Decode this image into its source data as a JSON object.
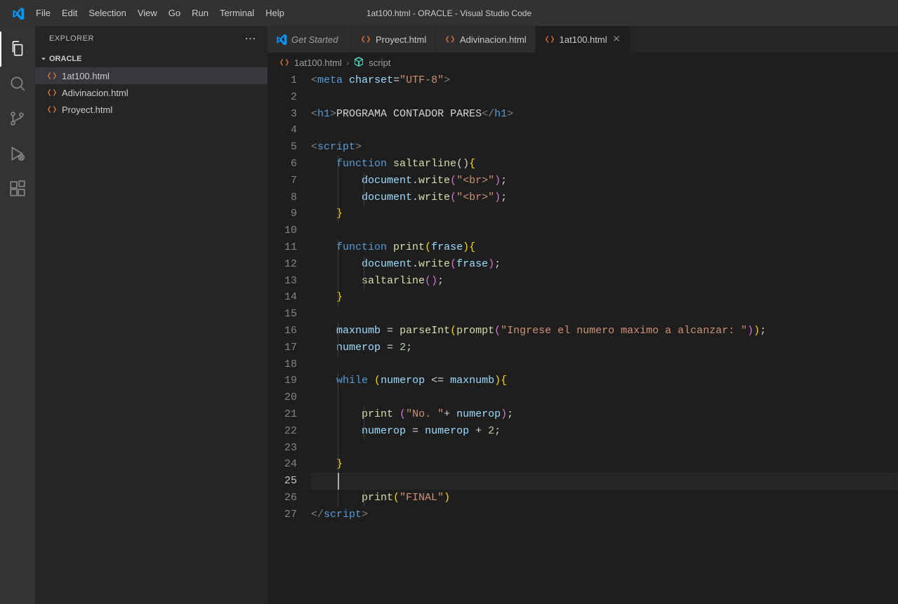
{
  "window": {
    "title": "1at100.html - ORACLE - Visual Studio Code"
  },
  "menu": [
    "File",
    "Edit",
    "Selection",
    "View",
    "Go",
    "Run",
    "Terminal",
    "Help"
  ],
  "sidebar": {
    "header": "EXPLORER",
    "section": "ORACLE",
    "files": [
      {
        "name": "1at100.html",
        "selected": true
      },
      {
        "name": "Adivinacion.html",
        "selected": false
      },
      {
        "name": "Proyect.html",
        "selected": false
      }
    ]
  },
  "tabs": [
    {
      "label": "Get Started",
      "type": "vs",
      "active": false,
      "italic": true
    },
    {
      "label": "Proyect.html",
      "type": "html",
      "active": false,
      "italic": false
    },
    {
      "label": "Adivinacion.html",
      "type": "html",
      "active": false,
      "italic": false
    },
    {
      "label": "1at100.html",
      "type": "html",
      "active": true,
      "italic": false,
      "closable": true
    }
  ],
  "breadcrumbs": {
    "file": "1at100.html",
    "symbol": "script"
  },
  "code": {
    "lineCount": 27,
    "currentLine": 25,
    "lines": [
      [
        {
          "t": "punct",
          "v": "<"
        },
        {
          "t": "tag",
          "v": "meta"
        },
        {
          "t": "text",
          "v": " "
        },
        {
          "t": "attr",
          "v": "charset"
        },
        {
          "t": "op",
          "v": "="
        },
        {
          "t": "str",
          "v": "\"UTF-8\""
        },
        {
          "t": "punct",
          "v": ">"
        }
      ],
      [],
      [
        {
          "t": "punct",
          "v": "<"
        },
        {
          "t": "tag",
          "v": "h1"
        },
        {
          "t": "punct",
          "v": ">"
        },
        {
          "t": "text",
          "v": "PROGRAMA CONTADOR PARES"
        },
        {
          "t": "punct",
          "v": "</"
        },
        {
          "t": "tag",
          "v": "h1"
        },
        {
          "t": "punct",
          "v": ">"
        }
      ],
      [],
      [
        {
          "t": "punct",
          "v": "<"
        },
        {
          "t": "tag",
          "v": "script"
        },
        {
          "t": "punct",
          "v": ">"
        }
      ],
      [
        {
          "t": "text",
          "v": "    "
        },
        {
          "t": "kw",
          "v": "function"
        },
        {
          "t": "text",
          "v": " "
        },
        {
          "t": "fn",
          "v": "saltarline"
        },
        {
          "t": "op",
          "v": "()"
        },
        {
          "t": "brace",
          "v": "{"
        }
      ],
      [
        {
          "t": "text",
          "v": "        "
        },
        {
          "t": "var",
          "v": "document"
        },
        {
          "t": "op",
          "v": "."
        },
        {
          "t": "fn",
          "v": "write"
        },
        {
          "t": "brace2",
          "v": "("
        },
        {
          "t": "str",
          "v": "\"<br>\""
        },
        {
          "t": "brace2",
          "v": ")"
        },
        {
          "t": "op",
          "v": ";"
        }
      ],
      [
        {
          "t": "text",
          "v": "        "
        },
        {
          "t": "var",
          "v": "document"
        },
        {
          "t": "op",
          "v": "."
        },
        {
          "t": "fn",
          "v": "write"
        },
        {
          "t": "brace2",
          "v": "("
        },
        {
          "t": "str",
          "v": "\"<br>\""
        },
        {
          "t": "brace2",
          "v": ")"
        },
        {
          "t": "op",
          "v": ";"
        }
      ],
      [
        {
          "t": "text",
          "v": "    "
        },
        {
          "t": "brace",
          "v": "}"
        }
      ],
      [],
      [
        {
          "t": "text",
          "v": "    "
        },
        {
          "t": "kw",
          "v": "function"
        },
        {
          "t": "text",
          "v": " "
        },
        {
          "t": "fn",
          "v": "print"
        },
        {
          "t": "brace",
          "v": "("
        },
        {
          "t": "var",
          "v": "frase"
        },
        {
          "t": "brace",
          "v": ")"
        },
        {
          "t": "brace",
          "v": "{"
        }
      ],
      [
        {
          "t": "text",
          "v": "        "
        },
        {
          "t": "var",
          "v": "document"
        },
        {
          "t": "op",
          "v": "."
        },
        {
          "t": "fn",
          "v": "write"
        },
        {
          "t": "brace2",
          "v": "("
        },
        {
          "t": "var",
          "v": "frase"
        },
        {
          "t": "brace2",
          "v": ")"
        },
        {
          "t": "op",
          "v": ";"
        }
      ],
      [
        {
          "t": "text",
          "v": "        "
        },
        {
          "t": "fn",
          "v": "saltarline"
        },
        {
          "t": "brace2",
          "v": "()"
        },
        {
          "t": "op",
          "v": ";"
        }
      ],
      [
        {
          "t": "text",
          "v": "    "
        },
        {
          "t": "brace",
          "v": "}"
        }
      ],
      [],
      [
        {
          "t": "text",
          "v": "    "
        },
        {
          "t": "var",
          "v": "maxnumb"
        },
        {
          "t": "text",
          "v": " "
        },
        {
          "t": "op",
          "v": "="
        },
        {
          "t": "text",
          "v": " "
        },
        {
          "t": "fn",
          "v": "parseInt"
        },
        {
          "t": "brace",
          "v": "("
        },
        {
          "t": "fn",
          "v": "prompt"
        },
        {
          "t": "brace2",
          "v": "("
        },
        {
          "t": "str",
          "v": "\"Ingrese el numero maximo a alcanzar: \""
        },
        {
          "t": "brace2",
          "v": ")"
        },
        {
          "t": "brace",
          "v": ")"
        },
        {
          "t": "op",
          "v": ";"
        }
      ],
      [
        {
          "t": "text",
          "v": "    "
        },
        {
          "t": "var",
          "v": "numerop"
        },
        {
          "t": "text",
          "v": " "
        },
        {
          "t": "op",
          "v": "="
        },
        {
          "t": "text",
          "v": " "
        },
        {
          "t": "num",
          "v": "2"
        },
        {
          "t": "op",
          "v": ";"
        }
      ],
      [],
      [
        {
          "t": "text",
          "v": "    "
        },
        {
          "t": "kw",
          "v": "while"
        },
        {
          "t": "text",
          "v": " "
        },
        {
          "t": "brace",
          "v": "("
        },
        {
          "t": "var",
          "v": "numerop"
        },
        {
          "t": "text",
          "v": " "
        },
        {
          "t": "op",
          "v": "<="
        },
        {
          "t": "text",
          "v": " "
        },
        {
          "t": "var",
          "v": "maxnumb"
        },
        {
          "t": "brace",
          "v": ")"
        },
        {
          "t": "brace",
          "v": "{"
        }
      ],
      [],
      [
        {
          "t": "text",
          "v": "        "
        },
        {
          "t": "fn",
          "v": "print"
        },
        {
          "t": "text",
          "v": " "
        },
        {
          "t": "brace2",
          "v": "("
        },
        {
          "t": "str",
          "v": "\"No. \""
        },
        {
          "t": "op",
          "v": "+"
        },
        {
          "t": "text",
          "v": " "
        },
        {
          "t": "var",
          "v": "numerop"
        },
        {
          "t": "brace2",
          "v": ")"
        },
        {
          "t": "op",
          "v": ";"
        }
      ],
      [
        {
          "t": "text",
          "v": "        "
        },
        {
          "t": "var",
          "v": "numerop"
        },
        {
          "t": "text",
          "v": " "
        },
        {
          "t": "op",
          "v": "="
        },
        {
          "t": "text",
          "v": " "
        },
        {
          "t": "var",
          "v": "numerop"
        },
        {
          "t": "text",
          "v": " "
        },
        {
          "t": "op",
          "v": "+"
        },
        {
          "t": "text",
          "v": " "
        },
        {
          "t": "num",
          "v": "2"
        },
        {
          "t": "op",
          "v": ";"
        }
      ],
      [],
      [
        {
          "t": "text",
          "v": "    "
        },
        {
          "t": "brace",
          "v": "}"
        }
      ],
      [
        {
          "t": "text",
          "v": "    "
        }
      ],
      [
        {
          "t": "text",
          "v": "        "
        },
        {
          "t": "fn",
          "v": "print"
        },
        {
          "t": "brace",
          "v": "("
        },
        {
          "t": "str",
          "v": "\"FINAL\""
        },
        {
          "t": "brace",
          "v": ")"
        }
      ],
      [
        {
          "t": "punct",
          "v": "</"
        },
        {
          "t": "tag",
          "v": "script"
        },
        {
          "t": "punct",
          "v": ">"
        }
      ]
    ],
    "indentGuides": {
      "6": [
        1
      ],
      "7": [
        1,
        2
      ],
      "8": [
        1,
        2
      ],
      "9": [
        1
      ],
      "11": [
        1
      ],
      "12": [
        1,
        2
      ],
      "13": [
        1,
        2
      ],
      "14": [
        1
      ],
      "16": [
        1
      ],
      "17": [
        1
      ],
      "19": [
        1
      ],
      "20": [
        1
      ],
      "21": [
        1,
        2
      ],
      "22": [
        1,
        2
      ],
      "23": [
        1
      ],
      "24": [
        1
      ],
      "25": [
        1
      ],
      "26": [
        1,
        2
      ]
    }
  }
}
